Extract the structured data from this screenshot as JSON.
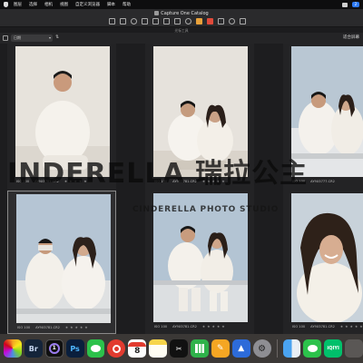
{
  "menubar": {
    "items": [
      "图层",
      "选择",
      "相机",
      "视图",
      "自定义浏览器",
      "脚本",
      "帮助"
    ],
    "right_icons": [
      "control-center-icon",
      "notification-badge"
    ],
    "badge_count": "2"
  },
  "window": {
    "title": "Capture One Catalog",
    "toolset_label": "光标工具"
  },
  "browser": {
    "sort_value": "日期",
    "right_label": "适合屏幕"
  },
  "photos": [
    {
      "iso": "ISO 100",
      "filename": "AY9X3781.CR2",
      "stars": "★ ★ ★ ★ ★"
    },
    {
      "iso": "ISO 100",
      "filename": "AY9X3781.CR2",
      "stars": "★ ★ ★ ★ ★"
    },
    {
      "iso": "ISO 100",
      "filename": "AY9X3777.CR2",
      "stars": "★ ★"
    },
    {
      "iso": "ISO 100",
      "filename": "AY9X3781.CR2",
      "stars": "★ ★ ★ ★ ★"
    },
    {
      "iso": "ISO 100",
      "filename": "AY9X3781.CR2",
      "stars": "★ ★ ★ ★ ★"
    },
    {
      "iso": "ISO 100",
      "filename": "AY9X3781.CR2",
      "stars": "★ ★ ★ ★ ★"
    }
  ],
  "watermark": {
    "line1": "INDERELLA 瑞拉公主",
    "line2": "CINDERELLA PHOTO STUDIO"
  },
  "dock": {
    "calendar_day": "8",
    "apps": [
      {
        "icon": "photos-icon",
        "label": ""
      },
      {
        "icon": "bridge-icon",
        "label": "Br"
      },
      {
        "icon": "capture-one-icon",
        "label": "1"
      },
      {
        "icon": "photoshop-icon",
        "label": "Ps"
      },
      {
        "icon": "wechat-icon",
        "label": ""
      },
      {
        "icon": "netease-music-icon",
        "label": ""
      },
      {
        "icon": "calendar-icon",
        "label": "8"
      },
      {
        "icon": "notes-icon",
        "label": ""
      },
      {
        "icon": "capcut-icon",
        "label": ""
      },
      {
        "icon": "numbers-icon",
        "label": ""
      },
      {
        "icon": "pages-icon",
        "label": ""
      },
      {
        "icon": "keynote-icon",
        "label": ""
      },
      {
        "icon": "settings-icon",
        "label": ""
      },
      {
        "icon": "finder-icon",
        "label": ""
      },
      {
        "icon": "wechat-icon",
        "label": ""
      },
      {
        "icon": "iqiyi-icon",
        "label": "iQIYI"
      },
      {
        "icon": "app-icon",
        "label": ""
      }
    ]
  }
}
